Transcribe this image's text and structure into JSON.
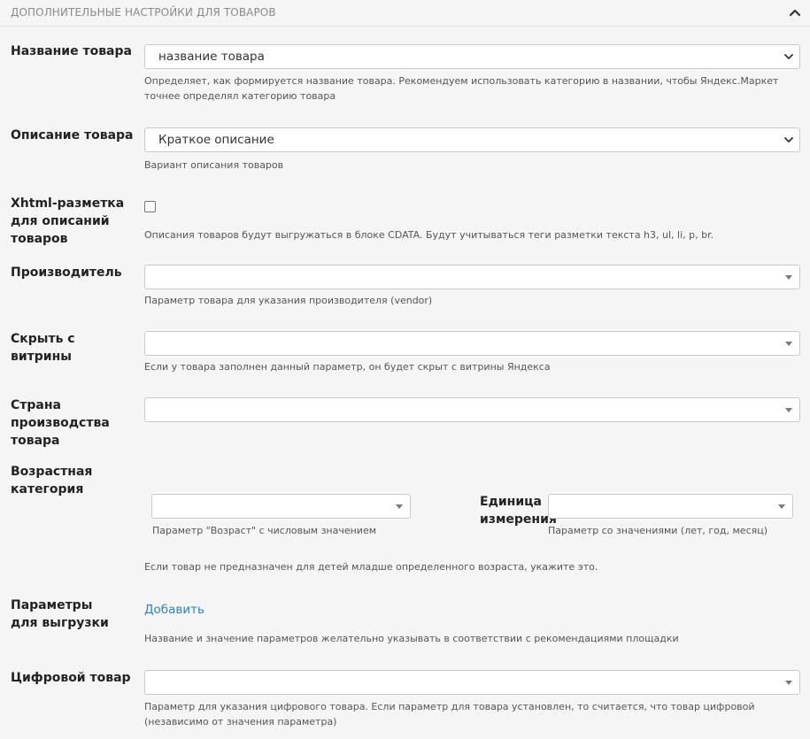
{
  "section": {
    "title": "ДОПОЛНИТЕЛЬНЫЕ НАСТРОЙКИ ДЛЯ ТОВАРОВ"
  },
  "fields": {
    "product_name": {
      "label": "Название товара",
      "value": "название товара",
      "hint": "Определяет, как формируется название товара. Рекомендуем использовать категорию в названии, чтобы Яндекс.Маркет точнее определял категорию товара"
    },
    "product_description": {
      "label": "Описание товара",
      "value": "Краткое описание",
      "hint": "Вариант описания товаров"
    },
    "xhtml": {
      "label": "Xhtml-разметка для описаний товаров",
      "hint": "Описания товаров будут выгружаться в блоке CDATA. Будут учитываться теги разметки текста h3, ul, li, p, br."
    },
    "vendor": {
      "label": "Производитель",
      "value": "",
      "hint": "Параметр товара для указания производителя (vendor)"
    },
    "hide_showcase": {
      "label": "Скрыть с витрины",
      "value": "",
      "hint": "Если у товара заполнен данный параметр, он будет скрыт с витрины Яндекса"
    },
    "country": {
      "label": "Страна производства товара",
      "value": ""
    },
    "age": {
      "label": "Возрастная категория",
      "age_hint": "Параметр \"Возраст\" с числовым значением",
      "unit_label": "Единица измерения",
      "unit_hint": "Параметр со значениями (лет, год, месяц)",
      "hint": "Если товар не предназначен для детей младше определенного возраста, укажите это."
    },
    "export_params": {
      "label": "Параметры для выгрузки",
      "add_link": "Добавить",
      "hint": "Название и значение параметров желательно указывать в соответствии с рекомендациями площадки"
    },
    "digital": {
      "label": "Цифровой товар",
      "value": "",
      "hint": "Параметр для указания цифрового товара. Если параметр для товара установлен, то считается, что товар цифровой (независимо от значения параметра)"
    }
  },
  "icons": {
    "collapse": "chevron-up-icon",
    "select_open": "chevron-down-icon",
    "select_caret": "caret-down-icon"
  },
  "colors": {
    "link": "#2f7fbf",
    "background": "#f5f5f5"
  }
}
